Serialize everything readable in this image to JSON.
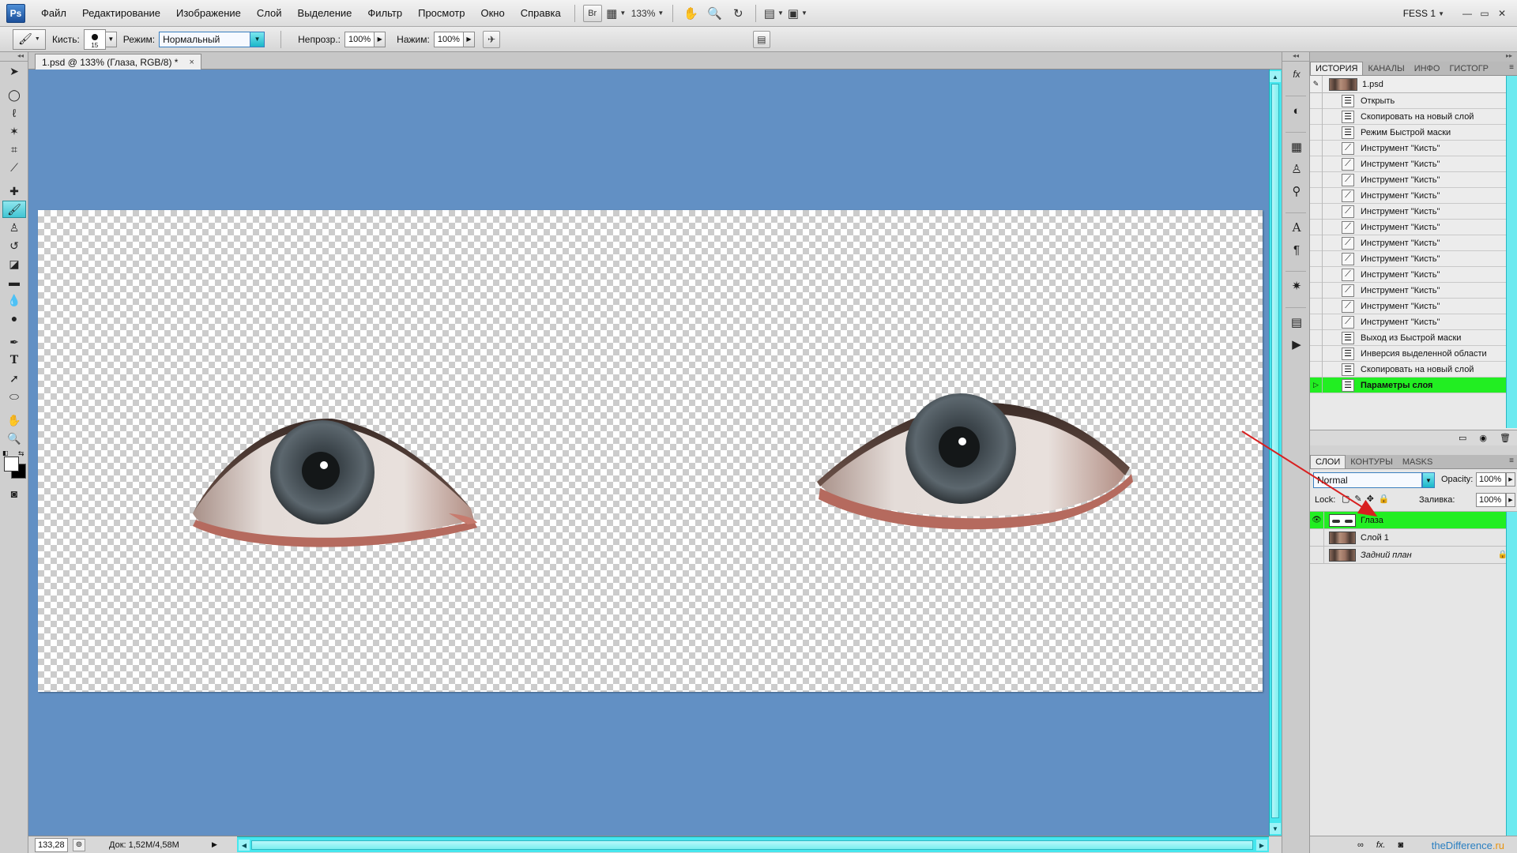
{
  "menubar": {
    "app_logo": "Ps",
    "items": [
      "Файл",
      "Редактирование",
      "Изображение",
      "Слой",
      "Выделение",
      "Фильтр",
      "Просмотр",
      "Окно",
      "Справка"
    ],
    "bridge_label": "Br",
    "zoom": "133%",
    "workspace": "FESS 1",
    "window_controls": [
      "—",
      "▭",
      "✕"
    ]
  },
  "options": {
    "brush_label": "Кисть:",
    "brush_size": "15",
    "mode_label": "Режим:",
    "mode_value": "Нормальный",
    "opacity_label": "Непрозр.:",
    "opacity_value": "100%",
    "flow_label": "Нажим:",
    "flow_value": "100%"
  },
  "document": {
    "tab_title": "1.psd @ 133% (Глаза, RGB/8) *",
    "close": "×",
    "canvas_bg": "#6290c4"
  },
  "status": {
    "zoom": "133,28",
    "doc_info": "Док: 1,52M/4,58M"
  },
  "history": {
    "tabs": [
      "ИСТОРИЯ",
      "КАНАЛЫ",
      "ИНФО",
      "ГИСТОГР"
    ],
    "snapshot": "1.psd",
    "steps": [
      "Открыть",
      "Скопировать на новый слой",
      "Режим Быстрой маски",
      "Инструмент \"Кисть\"",
      "Инструмент \"Кисть\"",
      "Инструмент \"Кисть\"",
      "Инструмент \"Кисть\"",
      "Инструмент \"Кисть\"",
      "Инструмент \"Кисть\"",
      "Инструмент \"Кисть\"",
      "Инструмент \"Кисть\"",
      "Инструмент \"Кисть\"",
      "Инструмент \"Кисть\"",
      "Инструмент \"Кисть\"",
      "Инструмент \"Кисть\"",
      "Выход из Быстрой маски",
      "Инверсия выделенной области",
      "Скопировать на новый слой",
      "Параметры слоя"
    ],
    "active_step_color": "#22ee22"
  },
  "layers": {
    "tabs": [
      "СЛОИ",
      "КОНТУРЫ",
      "MASKS"
    ],
    "blend_mode": "Normal",
    "opacity_label": "Opacity:",
    "opacity_value": "100%",
    "lock_label": "Lock:",
    "fill_label": "Заливка:",
    "fill_value": "100%",
    "items": [
      {
        "name": "Глаза",
        "active": true
      },
      {
        "name": "Слой 1",
        "active": false
      },
      {
        "name": "Задний план",
        "active": false
      }
    ]
  },
  "watermark": {
    "main": "theDifference",
    "suffix": ".ru"
  },
  "accent_colors": {
    "scrollbar": "#46e7ee",
    "selection": "#22ee22",
    "annotation_arrow": "#d82020"
  }
}
